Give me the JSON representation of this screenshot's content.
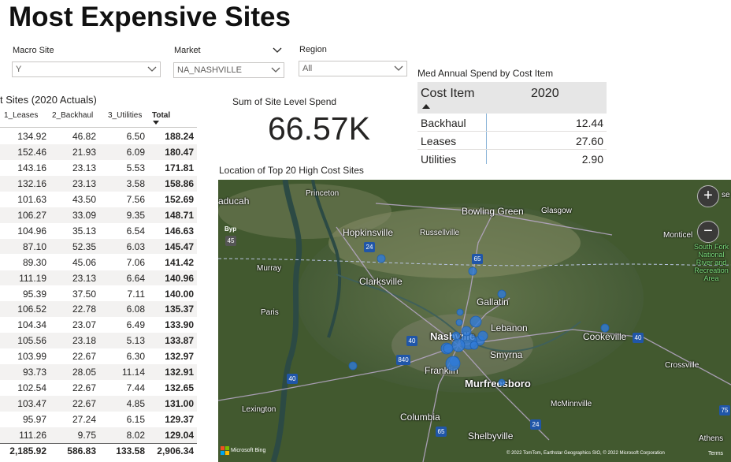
{
  "title": "Most Expensive Sites",
  "slicers": [
    {
      "label": "Macro Site",
      "value": "Y"
    },
    {
      "label": "Market",
      "value": "NA_NASHVILLE"
    },
    {
      "label": "Region",
      "value": "All"
    }
  ],
  "table": {
    "title": "t Sites (2020 Actuals)",
    "headers": [
      "1_Leases",
      "2_Backhaul",
      "3_Utilities",
      "Total"
    ],
    "rows": [
      [
        "134.92",
        "46.82",
        "6.50",
        "188.24"
      ],
      [
        "152.46",
        "21.93",
        "6.09",
        "180.47"
      ],
      [
        "143.16",
        "23.13",
        "5.53",
        "171.81"
      ],
      [
        "132.16",
        "23.13",
        "3.58",
        "158.86"
      ],
      [
        "101.63",
        "43.50",
        "7.56",
        "152.69"
      ],
      [
        "106.27",
        "33.09",
        "9.35",
        "148.71"
      ],
      [
        "104.96",
        "35.13",
        "6.54",
        "146.63"
      ],
      [
        "87.10",
        "52.35",
        "6.03",
        "145.47"
      ],
      [
        "89.30",
        "45.06",
        "7.06",
        "141.42"
      ],
      [
        "111.19",
        "23.13",
        "6.64",
        "140.96"
      ],
      [
        "95.39",
        "37.50",
        "7.11",
        "140.00"
      ],
      [
        "106.52",
        "22.78",
        "6.08",
        "135.37"
      ],
      [
        "104.34",
        "23.07",
        "6.49",
        "133.90"
      ],
      [
        "105.56",
        "23.18",
        "5.13",
        "133.87"
      ],
      [
        "103.99",
        "22.67",
        "6.30",
        "132.97"
      ],
      [
        "93.73",
        "28.05",
        "11.14",
        "132.91"
      ],
      [
        "102.54",
        "22.67",
        "7.44",
        "132.65"
      ],
      [
        "103.47",
        "22.67",
        "4.85",
        "131.00"
      ],
      [
        "95.97",
        "27.24",
        "6.15",
        "129.37"
      ],
      [
        "111.26",
        "9.75",
        "8.02",
        "129.04"
      ]
    ],
    "totals": [
      "2,185.92",
      "586.83",
      "133.58",
      "2,906.34"
    ]
  },
  "card": {
    "label": "Sum of Site Level Spend",
    "value": "66.57K"
  },
  "matrix": {
    "title": "Med Annual Spend by Cost Item",
    "col_header": "Cost Item",
    "year_header": "2020",
    "rows": [
      {
        "item": "Backhaul",
        "value": "12.44"
      },
      {
        "item": "Leases",
        "value": "27.60"
      },
      {
        "item": "Utilities",
        "value": "2.90"
      }
    ]
  },
  "map": {
    "title": "Location of Top 20 High Cost Sites",
    "cities": {
      "paducah": "aducah",
      "princeton": "Princeton",
      "bowling_green": "Bowling Green",
      "glasgow": "Glasgow",
      "hopkinsville": "Hopkinsville",
      "russellville": "Russellville",
      "monticello": "Monticel",
      "murray": "Murray",
      "clarksville": "Clarksville",
      "gallatin": "Gallatin",
      "paris": "Paris",
      "lebanon": "Lebanon",
      "nashville": "Nashville",
      "cookeville": "Cookeville",
      "smyrna": "Smyrna",
      "franklin": "Franklin",
      "crossville": "Crossville",
      "murfreesboro": "Murfreesboro",
      "lexington": "Lexington",
      "mcminnville": "McMinnville",
      "columbia": "Columbia",
      "shelbyville": "Shelbyville",
      "athens": "Athens",
      "south_fork": "South Fork National River and Recreation Area"
    },
    "zoom_in": "+",
    "zoom_out": "−",
    "partial_label": "se",
    "highway_labels": [
      "24",
      "65",
      "40",
      "840",
      "40",
      "40",
      "24",
      "65",
      "75",
      "45"
    ],
    "byp": "Byp",
    "bing": "Microsoft Bing",
    "copyright": "© 2022 TomTom, Earthstar Geographics SIO, © 2022 Microsoft Corporation",
    "terms": "Terms",
    "bubble_color": "#2f7bd8"
  }
}
